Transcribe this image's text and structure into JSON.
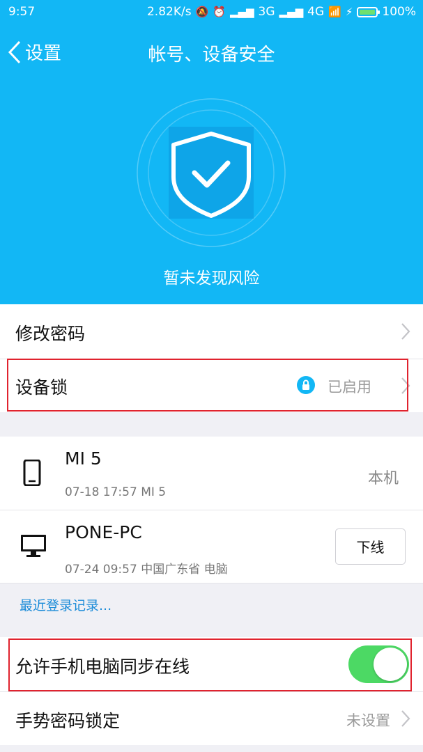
{
  "status_bar": {
    "time": "9:57",
    "net_speed": "2.82K/s",
    "network_1": "3G",
    "network_2": "4G",
    "battery": "100%"
  },
  "nav": {
    "back_label": "设置",
    "title": "帐号、设备安全"
  },
  "hero": {
    "status_text": "暂未发现风险"
  },
  "settings": {
    "change_password": "修改密码",
    "device_lock": "设备锁",
    "device_lock_status": "已启用"
  },
  "devices": [
    {
      "name": "MI 5",
      "detail": "07-18 17:57 MI 5",
      "tag": "本机",
      "icon": "phone-icon"
    },
    {
      "name": "PONE-PC",
      "detail": "07-24 09:57 中国广东省 电脑",
      "action": "下线",
      "icon": "monitor-icon"
    }
  ],
  "recent_login_link": "最近登录记录...",
  "sync_online": {
    "label": "允许手机电脑同步在线",
    "enabled": true
  },
  "gesture_lock": {
    "label": "手势密码锁定",
    "status": "未设置"
  },
  "colors": {
    "accent": "#12b7f5",
    "toggle_on": "#4cd964",
    "highlight": "#e0232e",
    "link": "#1a8bd8"
  }
}
